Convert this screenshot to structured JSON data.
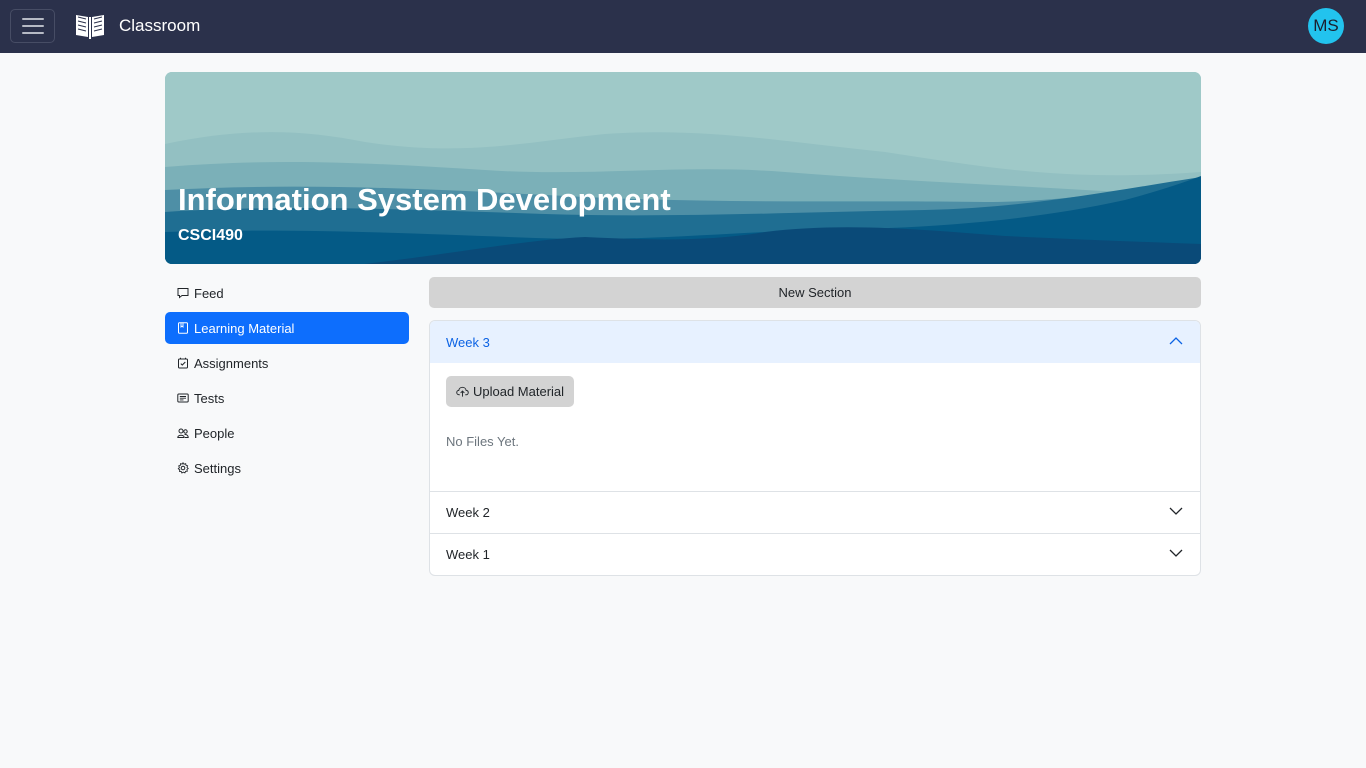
{
  "navbar": {
    "menu_icon": "hamburger-menu-icon",
    "logo_icon": "open-book-icon",
    "brand": "Classroom",
    "avatar_initials": "MS"
  },
  "course": {
    "title": "Information System Development",
    "code": "CSCI490"
  },
  "sidebar": {
    "items": [
      {
        "label": "Feed",
        "icon": "chat-square-icon"
      },
      {
        "label": "Learning Material",
        "icon": "journal-icon",
        "active": true
      },
      {
        "label": "Assignments",
        "icon": "calendar-check-icon"
      },
      {
        "label": "Tests",
        "icon": "card-text-icon"
      },
      {
        "label": "People",
        "icon": "people-icon"
      },
      {
        "label": "Settings",
        "icon": "gear-icon"
      }
    ]
  },
  "main": {
    "new_section_label": "New Section",
    "sections": [
      {
        "label": "Week 3",
        "expanded": true,
        "upload_label": "Upload Material",
        "empty_text": "No Files Yet."
      },
      {
        "label": "Week 2",
        "expanded": false
      },
      {
        "label": "Week 1",
        "expanded": false
      }
    ]
  },
  "colors": {
    "navbar_bg": "#2b314b",
    "accent": "#0d6efd",
    "avatar_bg": "#22c3ee",
    "page_bg": "#f8f9fa"
  }
}
